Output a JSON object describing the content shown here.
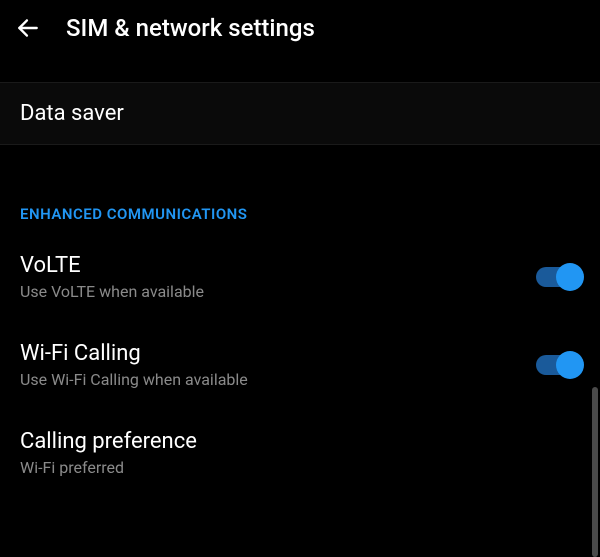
{
  "header": {
    "title": "SIM & network settings"
  },
  "data_saver": {
    "title": "Data saver"
  },
  "section": {
    "header": "ENHANCED COMMUNICATIONS"
  },
  "settings": {
    "volte": {
      "title": "VoLTE",
      "subtitle": "Use VoLTE when available",
      "enabled": true
    },
    "wifi_calling": {
      "title": "Wi-Fi Calling",
      "subtitle": "Use Wi-Fi Calling when available",
      "enabled": true
    },
    "calling_pref": {
      "title": "Calling preference",
      "subtitle": "Wi-Fi preferred"
    }
  },
  "colors": {
    "accent": "#2196f3"
  }
}
